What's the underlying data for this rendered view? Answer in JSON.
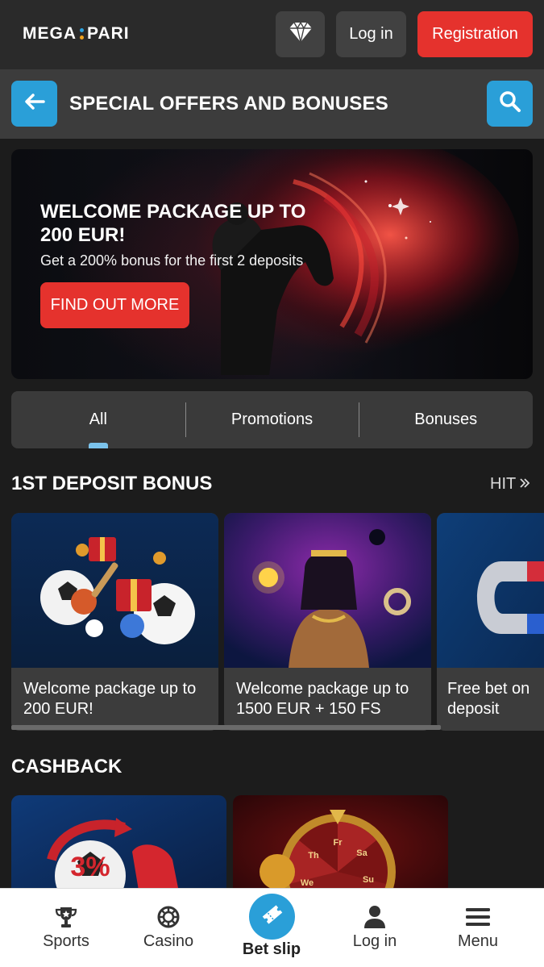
{
  "header": {
    "logo_left": "MEGA",
    "logo_right": "PARI",
    "vip_icon": "diamond-icon",
    "login_label": "Log in",
    "register_label": "Registration"
  },
  "titlebar": {
    "back_icon": "arrow-left-icon",
    "title": "SPECIAL OFFERS AND BONUSES",
    "search_icon": "search-icon"
  },
  "hero": {
    "title": "WELCOME PACKAGE UP TO 200 EUR!",
    "subtitle": "Get a 200% bonus for the first 2 deposits",
    "cta_label": "FIND OUT MORE"
  },
  "tabs": [
    {
      "label": "All",
      "active": true
    },
    {
      "label": "Promotions",
      "active": false
    },
    {
      "label": "Bonuses",
      "active": false
    }
  ],
  "sections": {
    "first_deposit": {
      "title": "1ST DEPOSIT BONUS",
      "link_label": "HIT",
      "cards": [
        {
          "label": "Welcome package up to 200 EUR!"
        },
        {
          "label": "Welcome package up to 1500 EUR + 150 FS"
        },
        {
          "label": "Free bet on deposit"
        }
      ]
    },
    "cashback": {
      "title": "CASHBACK",
      "card_badge": "3%",
      "wheel_labels": [
        "Fr",
        "Sa",
        "Su",
        "We",
        "Th"
      ]
    }
  },
  "bottom_nav": [
    {
      "label": "Sports",
      "icon": "trophy-icon"
    },
    {
      "label": "Casino",
      "icon": "casino-chip-icon"
    },
    {
      "label": "Bet slip",
      "icon": "ticket-icon"
    },
    {
      "label": "Log in",
      "icon": "user-icon"
    },
    {
      "label": "Menu",
      "icon": "menu-icon"
    }
  ],
  "colors": {
    "accent_blue": "#2a9fd8",
    "accent_red": "#e5322d",
    "background": "#1c1c1c"
  }
}
